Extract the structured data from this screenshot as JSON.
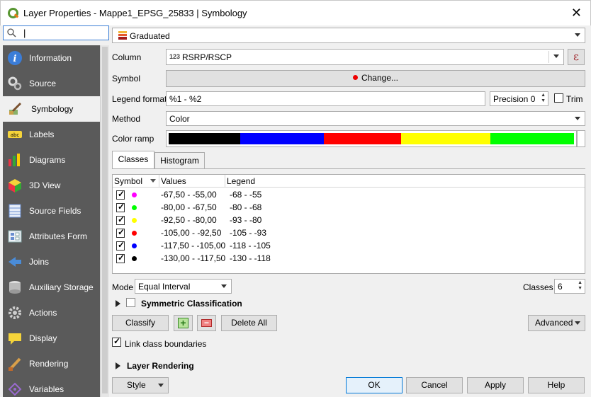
{
  "window": {
    "title": "Layer Properties - Mappe1_EPSG_25833 | Symbology",
    "close_glyph": "✕"
  },
  "search": {
    "value": "|",
    "icon": "search-icon"
  },
  "sidebar": {
    "items": [
      {
        "label": "Information",
        "icon": "information-icon"
      },
      {
        "label": "Source",
        "icon": "source-icon"
      },
      {
        "label": "Symbology",
        "icon": "symbology-icon",
        "selected": true
      },
      {
        "label": "Labels",
        "icon": "labels-icon"
      },
      {
        "label": "Diagrams",
        "icon": "diagrams-icon"
      },
      {
        "label": "3D View",
        "icon": "3d-view-icon"
      },
      {
        "label": "Source Fields",
        "icon": "source-fields-icon"
      },
      {
        "label": "Attributes Form",
        "icon": "attributes-form-icon"
      },
      {
        "label": "Joins",
        "icon": "joins-icon"
      },
      {
        "label": "Auxiliary Storage",
        "icon": "auxiliary-storage-icon"
      },
      {
        "label": "Actions",
        "icon": "actions-icon"
      },
      {
        "label": "Display",
        "icon": "display-icon"
      },
      {
        "label": "Rendering",
        "icon": "rendering-icon"
      },
      {
        "label": "Variables",
        "icon": "variables-icon"
      }
    ]
  },
  "renderer": {
    "value": "Graduated"
  },
  "form": {
    "column_label": "Column",
    "column_prefix": "123",
    "column_value": "RSRP/RSCP",
    "expression_glyph": "ε",
    "symbol_label": "Symbol",
    "change_label": "Change...",
    "legend_format_label": "Legend format",
    "legend_format_value": "%1 - %2",
    "precision_value": "Precision 0",
    "trim_label": "Trim",
    "method_label": "Method",
    "method_value": "Color",
    "color_ramp_label": "Color ramp",
    "color_ramp": [
      "#000000",
      "#0000ff",
      "#ff0000",
      "#ffff00",
      "#00ff00"
    ]
  },
  "tabs": {
    "classes": "Classes",
    "histogram": "Histogram"
  },
  "table": {
    "headers": {
      "symbol": "Symbol",
      "values": "Values",
      "legend": "Legend"
    },
    "rows": [
      {
        "color": "#ff00ff",
        "values": "-67,50 - -55,00",
        "legend": "-68 - -55",
        "checked": true
      },
      {
        "color": "#00ff00",
        "values": "-80,00 - -67,50",
        "legend": "-80 - -68",
        "checked": true
      },
      {
        "color": "#ffff00",
        "values": "-92,50 - -80,00",
        "legend": "-93 - -80",
        "checked": true
      },
      {
        "color": "#ff0000",
        "values": "-105,00 - -92,50",
        "legend": "-105 - -93",
        "checked": true
      },
      {
        "color": "#0000ff",
        "values": "-117,50 - -105,00",
        "legend": "-118 - -105",
        "checked": true
      },
      {
        "color": "#000000",
        "values": "-130,00 - -117,50",
        "legend": "-130 - -118",
        "checked": true
      }
    ]
  },
  "mode": {
    "label": "Mode",
    "value": "Equal Interval",
    "classes_label": "Classes",
    "classes_value": "6"
  },
  "symmetric": {
    "label": "Symmetric Classification"
  },
  "buttons": {
    "classify": "Classify",
    "add_glyph": "+",
    "remove_glyph": "−",
    "delete_all": "Delete All",
    "advanced": "Advanced"
  },
  "link_boundaries": {
    "label": "Link class boundaries",
    "checked": true
  },
  "layer_rendering": {
    "label": "Layer Rendering"
  },
  "footer": {
    "style": "Style",
    "ok": "OK",
    "cancel": "Cancel",
    "apply": "Apply",
    "help": "Help"
  }
}
